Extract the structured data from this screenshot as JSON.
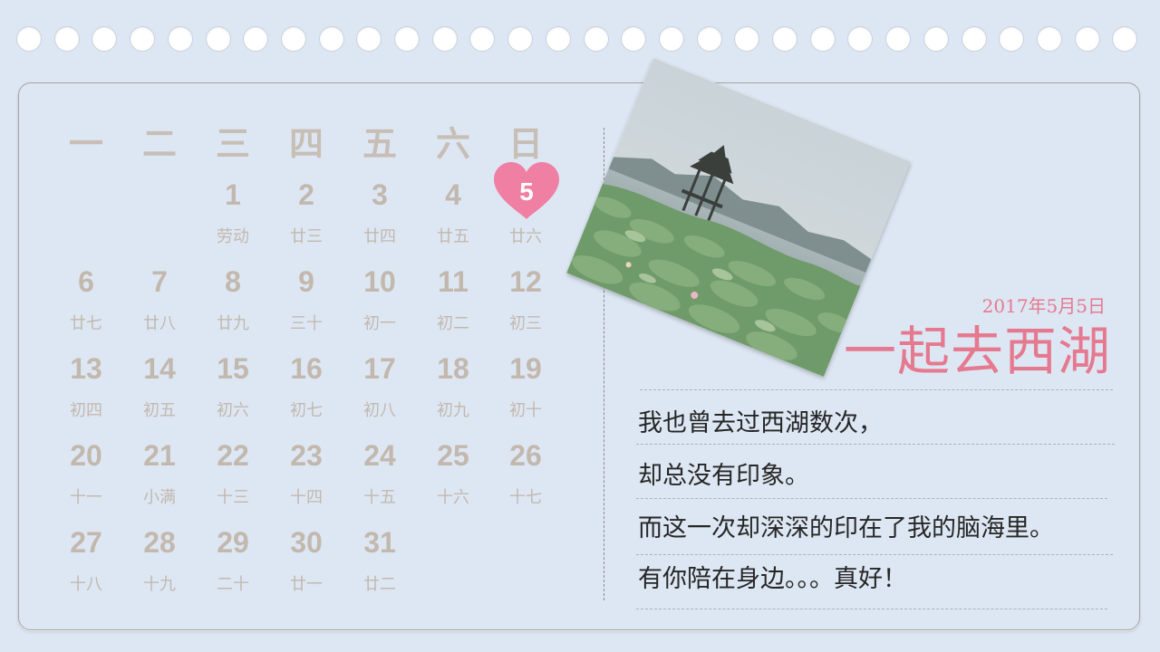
{
  "weekdays": [
    "一",
    "二",
    "三",
    "四",
    "五",
    "六",
    "日"
  ],
  "days": [
    {
      "day": "1",
      "lunar": "劳动",
      "col": 2,
      "row": 0
    },
    {
      "day": "2",
      "lunar": "廿三",
      "col": 3,
      "row": 0
    },
    {
      "day": "3",
      "lunar": "廿四",
      "col": 4,
      "row": 0
    },
    {
      "day": "4",
      "lunar": "廿五",
      "col": 5,
      "row": 0
    },
    {
      "day": "5",
      "lunar": "廿六",
      "col": 6,
      "row": 0,
      "highlight": true
    },
    {
      "day": "6",
      "lunar": "廿七",
      "col": 0,
      "row": 1
    },
    {
      "day": "7",
      "lunar": "廿八",
      "col": 1,
      "row": 1
    },
    {
      "day": "8",
      "lunar": "廿九",
      "col": 2,
      "row": 1
    },
    {
      "day": "9",
      "lunar": "三十",
      "col": 3,
      "row": 1
    },
    {
      "day": "10",
      "lunar": "初一",
      "col": 4,
      "row": 1
    },
    {
      "day": "11",
      "lunar": "初二",
      "col": 5,
      "row": 1
    },
    {
      "day": "12",
      "lunar": "初三",
      "col": 6,
      "row": 1
    },
    {
      "day": "13",
      "lunar": "初四",
      "col": 0,
      "row": 2
    },
    {
      "day": "14",
      "lunar": "初五",
      "col": 1,
      "row": 2
    },
    {
      "day": "15",
      "lunar": "初六",
      "col": 2,
      "row": 2
    },
    {
      "day": "16",
      "lunar": "初七",
      "col": 3,
      "row": 2
    },
    {
      "day": "17",
      "lunar": "初八",
      "col": 4,
      "row": 2
    },
    {
      "day": "18",
      "lunar": "初九",
      "col": 5,
      "row": 2
    },
    {
      "day": "19",
      "lunar": "初十",
      "col": 6,
      "row": 2
    },
    {
      "day": "20",
      "lunar": "十一",
      "col": 0,
      "row": 3
    },
    {
      "day": "21",
      "lunar": "小满",
      "col": 1,
      "row": 3
    },
    {
      "day": "22",
      "lunar": "十三",
      "col": 2,
      "row": 3
    },
    {
      "day": "23",
      "lunar": "十四",
      "col": 3,
      "row": 3
    },
    {
      "day": "24",
      "lunar": "十五",
      "col": 4,
      "row": 3
    },
    {
      "day": "25",
      "lunar": "十六",
      "col": 5,
      "row": 3
    },
    {
      "day": "26",
      "lunar": "十七",
      "col": 6,
      "row": 3
    },
    {
      "day": "27",
      "lunar": "十八",
      "col": 0,
      "row": 4
    },
    {
      "day": "28",
      "lunar": "十九",
      "col": 1,
      "row": 4
    },
    {
      "day": "29",
      "lunar": "二十",
      "col": 2,
      "row": 4
    },
    {
      "day": "30",
      "lunar": "廿一",
      "col": 3,
      "row": 4
    },
    {
      "day": "31",
      "lunar": "廿二",
      "col": 4,
      "row": 4
    }
  ],
  "entry": {
    "date": "2017年5月5日",
    "title": "一起去西湖",
    "lines": [
      "我也曾去过西湖数次，",
      "却总没有印象。",
      "而这一次却深深的印在了我的脑海里。",
      "有你陪在身边。。。真好！"
    ]
  },
  "colors": {
    "background": "#dde7f3",
    "accent_pink": "#e5798f",
    "heart": "#f07fa4",
    "calendar_text": "#c2b8ae",
    "body_text": "#262626"
  }
}
